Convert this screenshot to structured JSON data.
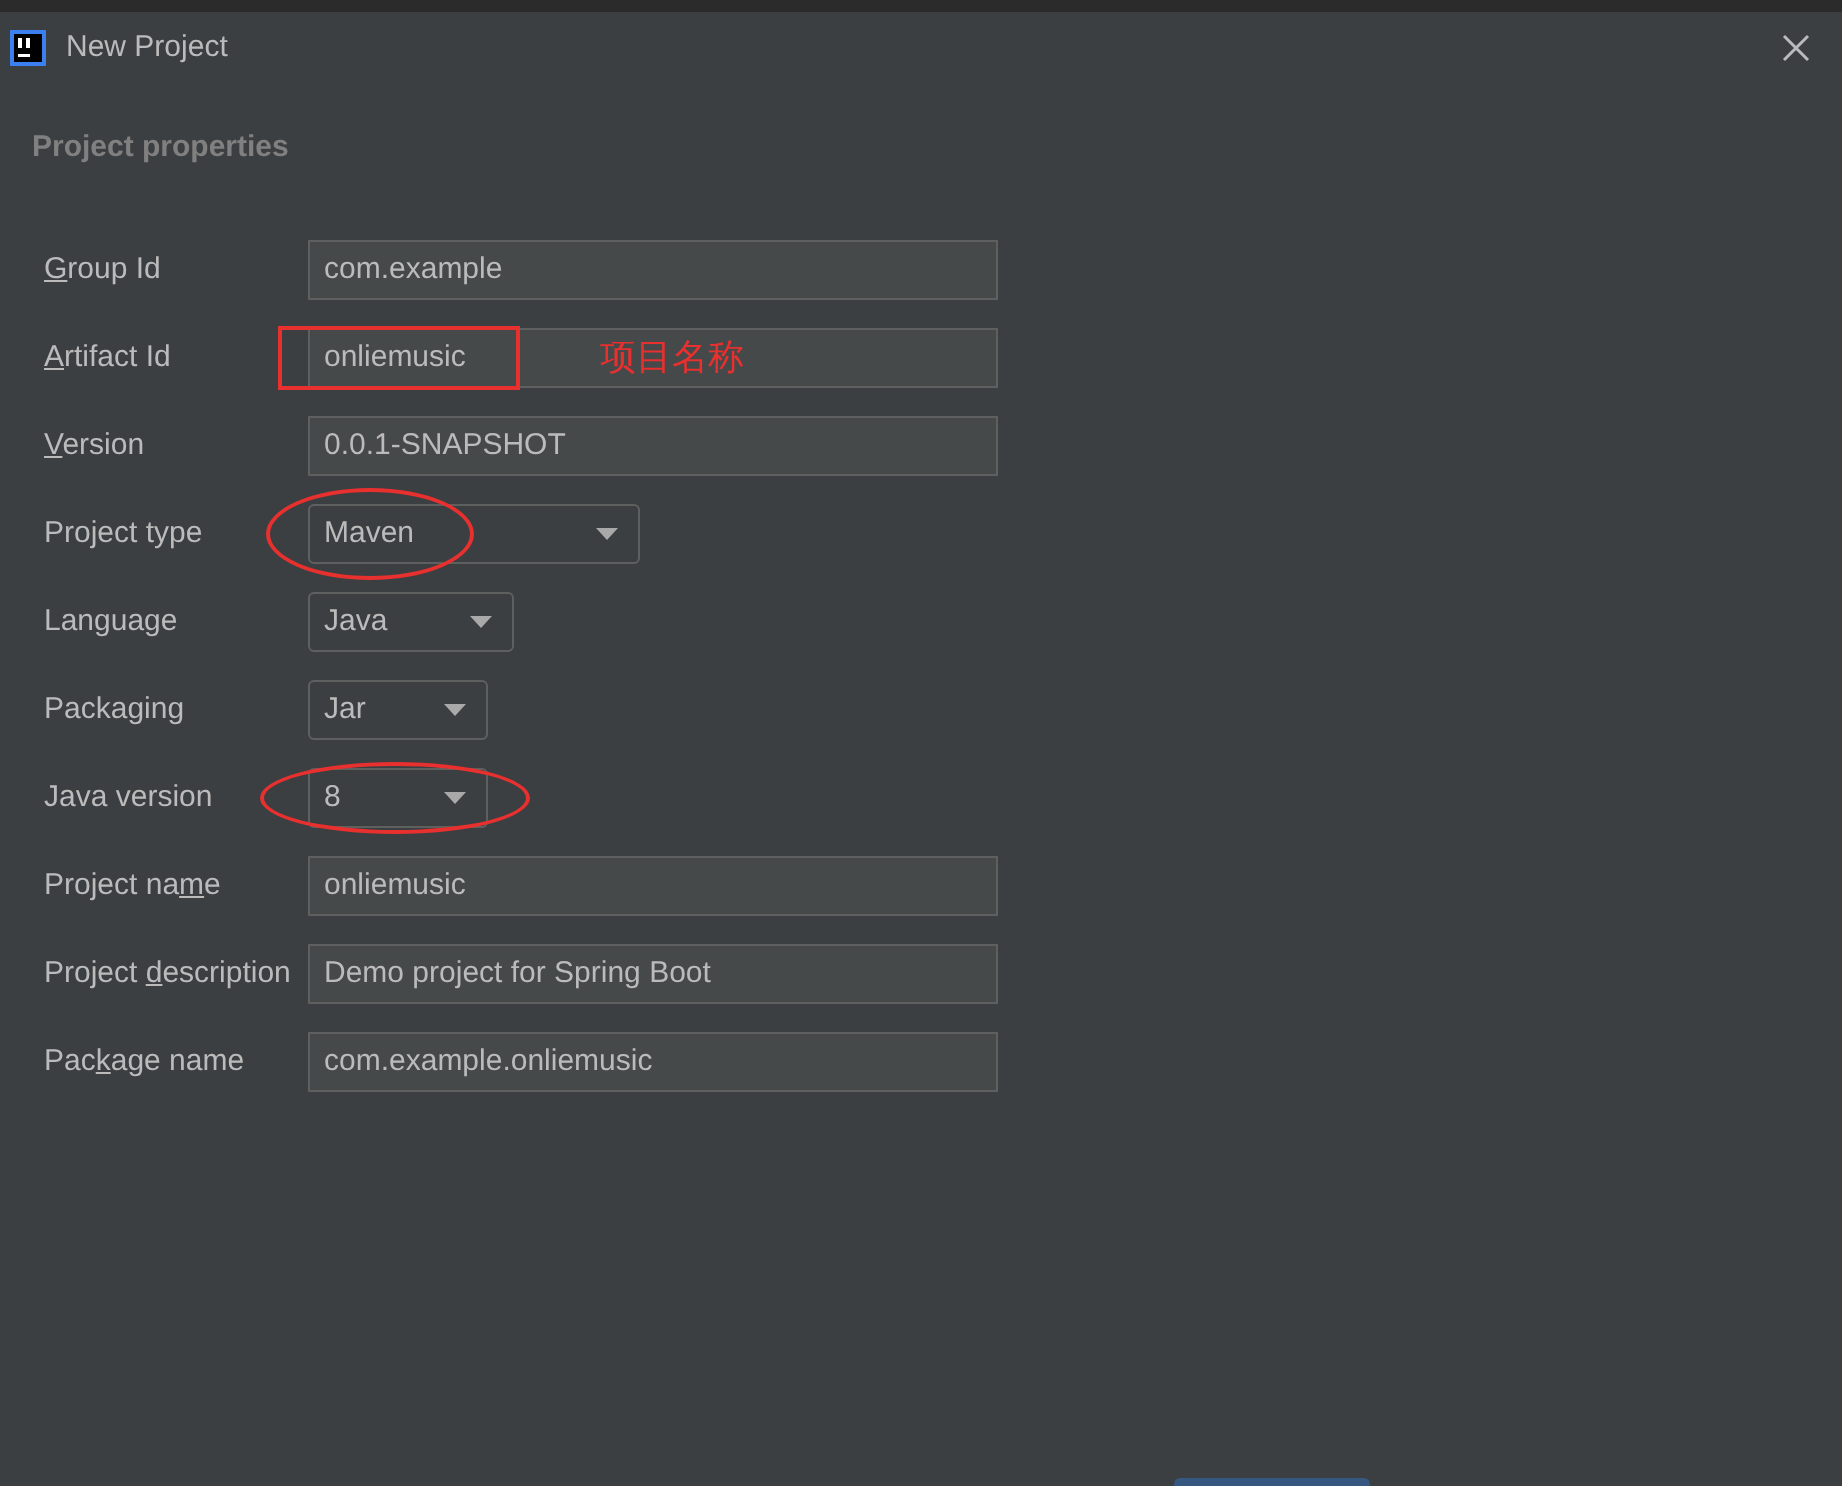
{
  "window": {
    "title": "New Project"
  },
  "section_title": "Project properties",
  "rows": [
    {
      "kind": "text",
      "mnemonic": "G",
      "label_end": "roup Id",
      "value": "com.example"
    },
    {
      "kind": "text",
      "mnemonic": "A",
      "label_end": "rtifact Id",
      "value": "onliemusic",
      "boxed": true,
      "note": "项目名称"
    },
    {
      "kind": "text",
      "mnemonic": "V",
      "label_end": "ersion",
      "value": "0.0.1-SNAPSHOT"
    },
    {
      "kind": "dropdown",
      "label_start": "Project type",
      "value": "Maven",
      "circled": true
    },
    {
      "kind": "dropdown",
      "label_start": "Language",
      "value": "Java"
    },
    {
      "kind": "dropdown",
      "label_start": "Packaging",
      "value": "Jar"
    },
    {
      "kind": "dropdown",
      "label_start": "Java version",
      "value": "8",
      "circled": true
    },
    {
      "kind": "text",
      "label_start": "Project na",
      "mnemonic": "m",
      "label_end": "e",
      "value": "onliemusic"
    },
    {
      "kind": "text",
      "label_start": "Project ",
      "mnemonic": "d",
      "label_end": "escription",
      "value": "Demo project for Spring Boot"
    },
    {
      "kind": "text",
      "label_start": "Pac",
      "mnemonic": "k",
      "label_end": "age name",
      "value": "com.example.onliemusic"
    }
  ]
}
